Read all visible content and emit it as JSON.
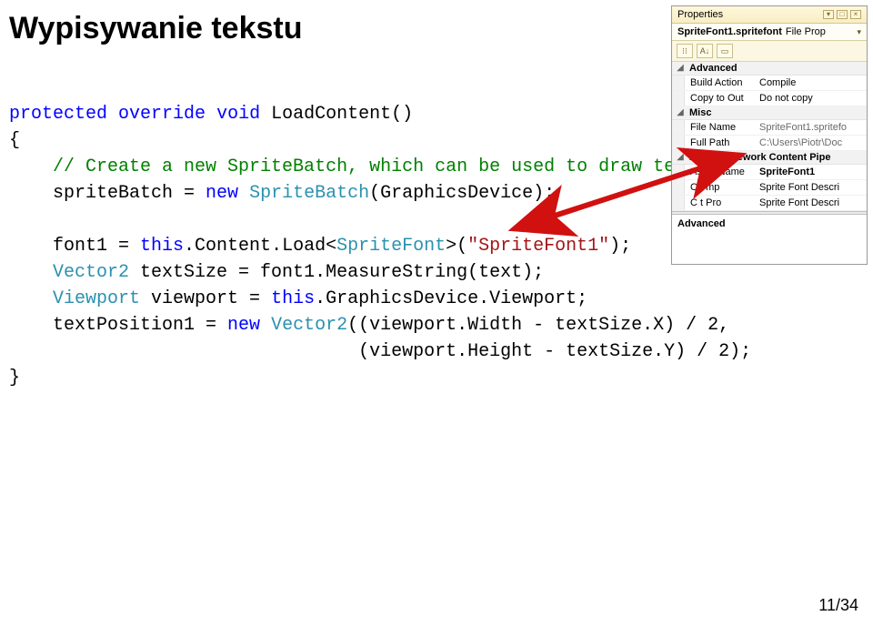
{
  "slide": {
    "title": "Wypisywanie tekstu",
    "page_number": "11/34"
  },
  "code": {
    "l1_a": "protected",
    "l1_b": "override",
    "l1_c": "void",
    "l1_d": " LoadContent()",
    "l2": "{",
    "l3_cm": "// Create a new SpriteBatch, which can be used to draw te",
    "l4_a": "    spriteBatch = ",
    "l4_kw": "new",
    "l4_b": " ",
    "l4_type": "SpriteBatch",
    "l4_c": "(GraphicsDevice);",
    "l6_a": "    font1 = ",
    "l6_kw": "this",
    "l6_b": ".Content.Load<",
    "l6_type": "SpriteFont",
    "l6_c": ">(",
    "l6_str": "\"SpriteFont1\"",
    "l6_d": ");",
    "l7_a": "    ",
    "l7_type": "Vector2",
    "l7_b": " textSize = font1.MeasureString(text);",
    "l8_a": "    ",
    "l8_type": "Viewport",
    "l8_b": " viewport = ",
    "l8_kw": "this",
    "l8_c": ".GraphicsDevice.Viewport;",
    "l9_a": "    textPosition1 = ",
    "l9_kw": "new",
    "l9_b": " ",
    "l9_type": "Vector2",
    "l9_c": "((viewport.Width - textSize.X) / 2,",
    "l10": "                                (viewport.Height - textSize.Y) / 2);",
    "l11": "}"
  },
  "panel": {
    "title": "Properties",
    "object_name": "SpriteFont1.spritefont",
    "object_type": "File Prop",
    "toolbar": {
      "btn_categorized": "⁝⁝",
      "btn_az": "A↓",
      "btn_props": "▭"
    },
    "cats": {
      "advanced": "Advanced",
      "misc": "Misc",
      "xna": "XNA Framework Content Pipe"
    },
    "rows": {
      "build_action": {
        "name": "Build Action",
        "value": "Compile"
      },
      "copy_to_out": {
        "name": "Copy to Out",
        "value": "Do not copy"
      },
      "file_name": {
        "name": "File Name",
        "value": "SpriteFont1.spritefo"
      },
      "full_path": {
        "name": "Full Path",
        "value": "C:\\Users\\Piotr\\Doc"
      },
      "asset_name": {
        "name": "Asset Name",
        "value": "SpriteFont1"
      },
      "content_imp": {
        "name": "Co        mp",
        "value": "Sprite Font Descri"
      },
      "content_proc": {
        "name": "C        t Pro",
        "value": "Sprite Font Descri"
      }
    },
    "desc_title": "Advanced",
    "desc_text": ""
  }
}
